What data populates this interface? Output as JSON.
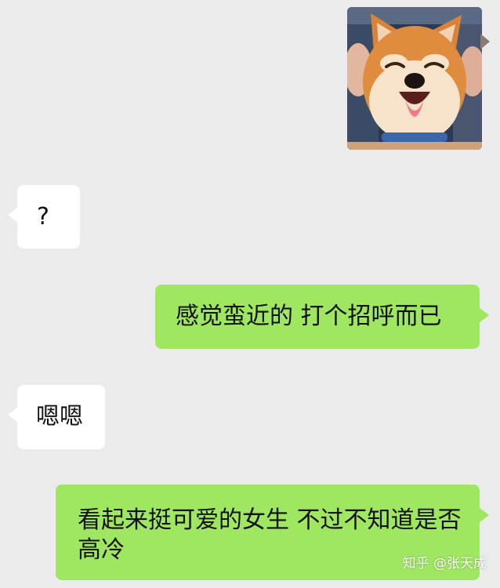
{
  "messages": [
    {
      "type": "image",
      "side": "out",
      "image": "shiba-inu-smiling"
    },
    {
      "type": "text",
      "side": "in",
      "text": "?"
    },
    {
      "type": "text",
      "side": "out",
      "text": "感觉蛮近的 打个招呼而已"
    },
    {
      "type": "text",
      "side": "in",
      "text": "嗯嗯"
    },
    {
      "type": "text",
      "side": "out",
      "text": "看起来挺可爱的女生 不过不知道是否高冷"
    }
  ],
  "watermark": "知乎 @张天成",
  "colors": {
    "background": "#ebebeb",
    "incoming_bubble": "#ffffff",
    "outgoing_bubble": "#9fe761"
  }
}
